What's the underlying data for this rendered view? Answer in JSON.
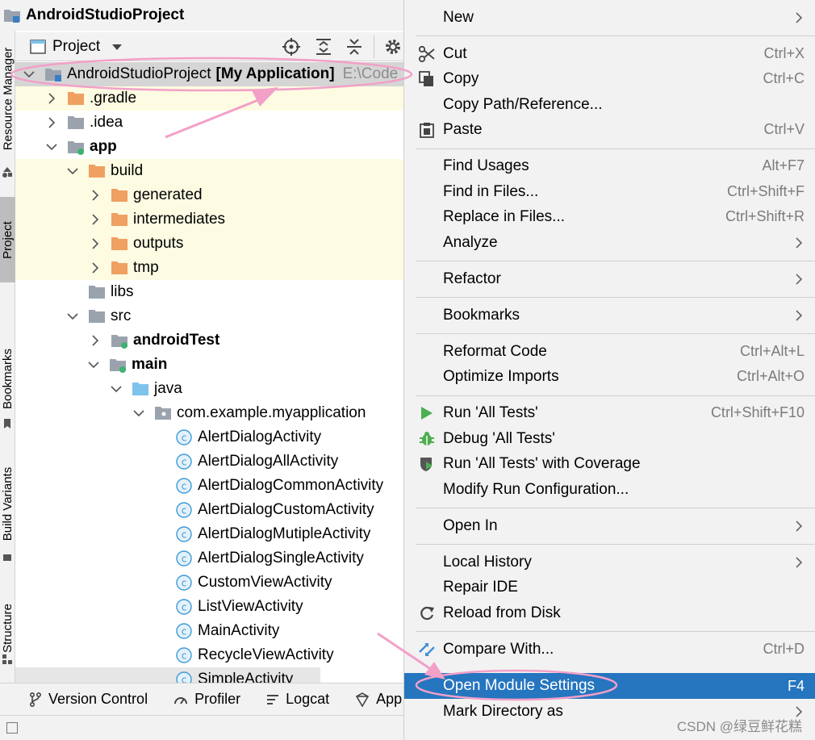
{
  "window": {
    "title": "AndroidStudioProject"
  },
  "side_tabs": [
    "Resource Manager",
    "Project",
    "Bookmarks",
    "Build Variants",
    "Structure"
  ],
  "project_panel": {
    "label": "Project"
  },
  "tree": [
    {
      "label": "AndroidStudioProject",
      "suffix": "[My Application]",
      "path": "E:\\Code"
    },
    {
      "label": ".gradle"
    },
    {
      "label": ".idea"
    },
    {
      "label": "app"
    },
    {
      "label": "build"
    },
    {
      "label": "generated"
    },
    {
      "label": "intermediates"
    },
    {
      "label": "outputs"
    },
    {
      "label": "tmp"
    },
    {
      "label": "libs"
    },
    {
      "label": "src"
    },
    {
      "label": "androidTest"
    },
    {
      "label": "main"
    },
    {
      "label": "java"
    },
    {
      "label": "com.example.myapplication"
    },
    {
      "label": "AlertDialogActivity"
    },
    {
      "label": "AlertDialogAllActivity"
    },
    {
      "label": "AlertDialogCommonActivity"
    },
    {
      "label": "AlertDialogCustomActivity"
    },
    {
      "label": "AlertDialogMutipleActivity"
    },
    {
      "label": "AlertDialogSingleActivity"
    },
    {
      "label": "CustomViewActivity"
    },
    {
      "label": "ListViewActivity"
    },
    {
      "label": "MainActivity"
    },
    {
      "label": "RecycleViewActivity"
    },
    {
      "label": "SimpleActivity"
    }
  ],
  "bottom_tools": [
    "Version Control",
    "Profiler",
    "Logcat",
    "App"
  ],
  "menu": [
    {
      "label": "New",
      "shortcut": ""
    },
    {
      "label": "Cut",
      "shortcut": "Ctrl+X"
    },
    {
      "label": "Copy",
      "shortcut": "Ctrl+C"
    },
    {
      "label": "Copy Path/Reference...",
      "shortcut": ""
    },
    {
      "label": "Paste",
      "shortcut": "Ctrl+V"
    },
    {
      "label": "Find Usages",
      "shortcut": "Alt+F7"
    },
    {
      "label": "Find in Files...",
      "shortcut": "Ctrl+Shift+F"
    },
    {
      "label": "Replace in Files...",
      "shortcut": "Ctrl+Shift+R"
    },
    {
      "label": "Analyze",
      "shortcut": ""
    },
    {
      "label": "Refactor",
      "shortcut": ""
    },
    {
      "label": "Bookmarks",
      "shortcut": ""
    },
    {
      "label": "Reformat Code",
      "shortcut": "Ctrl+Alt+L"
    },
    {
      "label": "Optimize Imports",
      "shortcut": "Ctrl+Alt+O"
    },
    {
      "label": "Run 'All Tests'",
      "shortcut": "Ctrl+Shift+F10"
    },
    {
      "label": "Debug 'All Tests'",
      "shortcut": ""
    },
    {
      "label": "Run 'All Tests' with Coverage",
      "shortcut": ""
    },
    {
      "label": "Modify Run Configuration...",
      "shortcut": ""
    },
    {
      "label": "Open In",
      "shortcut": ""
    },
    {
      "label": "Local History",
      "shortcut": ""
    },
    {
      "label": "Repair IDE",
      "shortcut": ""
    },
    {
      "label": "Reload from Disk",
      "shortcut": ""
    },
    {
      "label": "Compare With...",
      "shortcut": "Ctrl+D"
    },
    {
      "label": "Open Module Settings",
      "shortcut": "F4"
    },
    {
      "label": "Mark Directory as",
      "shortcut": ""
    }
  ],
  "watermark": "CSDN @绿豆鲜花糕",
  "colors": {
    "highlight": "#2675bf",
    "folder_orange": "#f0a060",
    "folder_gray": "#9aa3ad",
    "folder_blue": "#7ec3ec",
    "class_blue": "#3d9bd6",
    "annotation_pink": "#f2a0c8",
    "tree_yellow": "#fdfbe2"
  }
}
